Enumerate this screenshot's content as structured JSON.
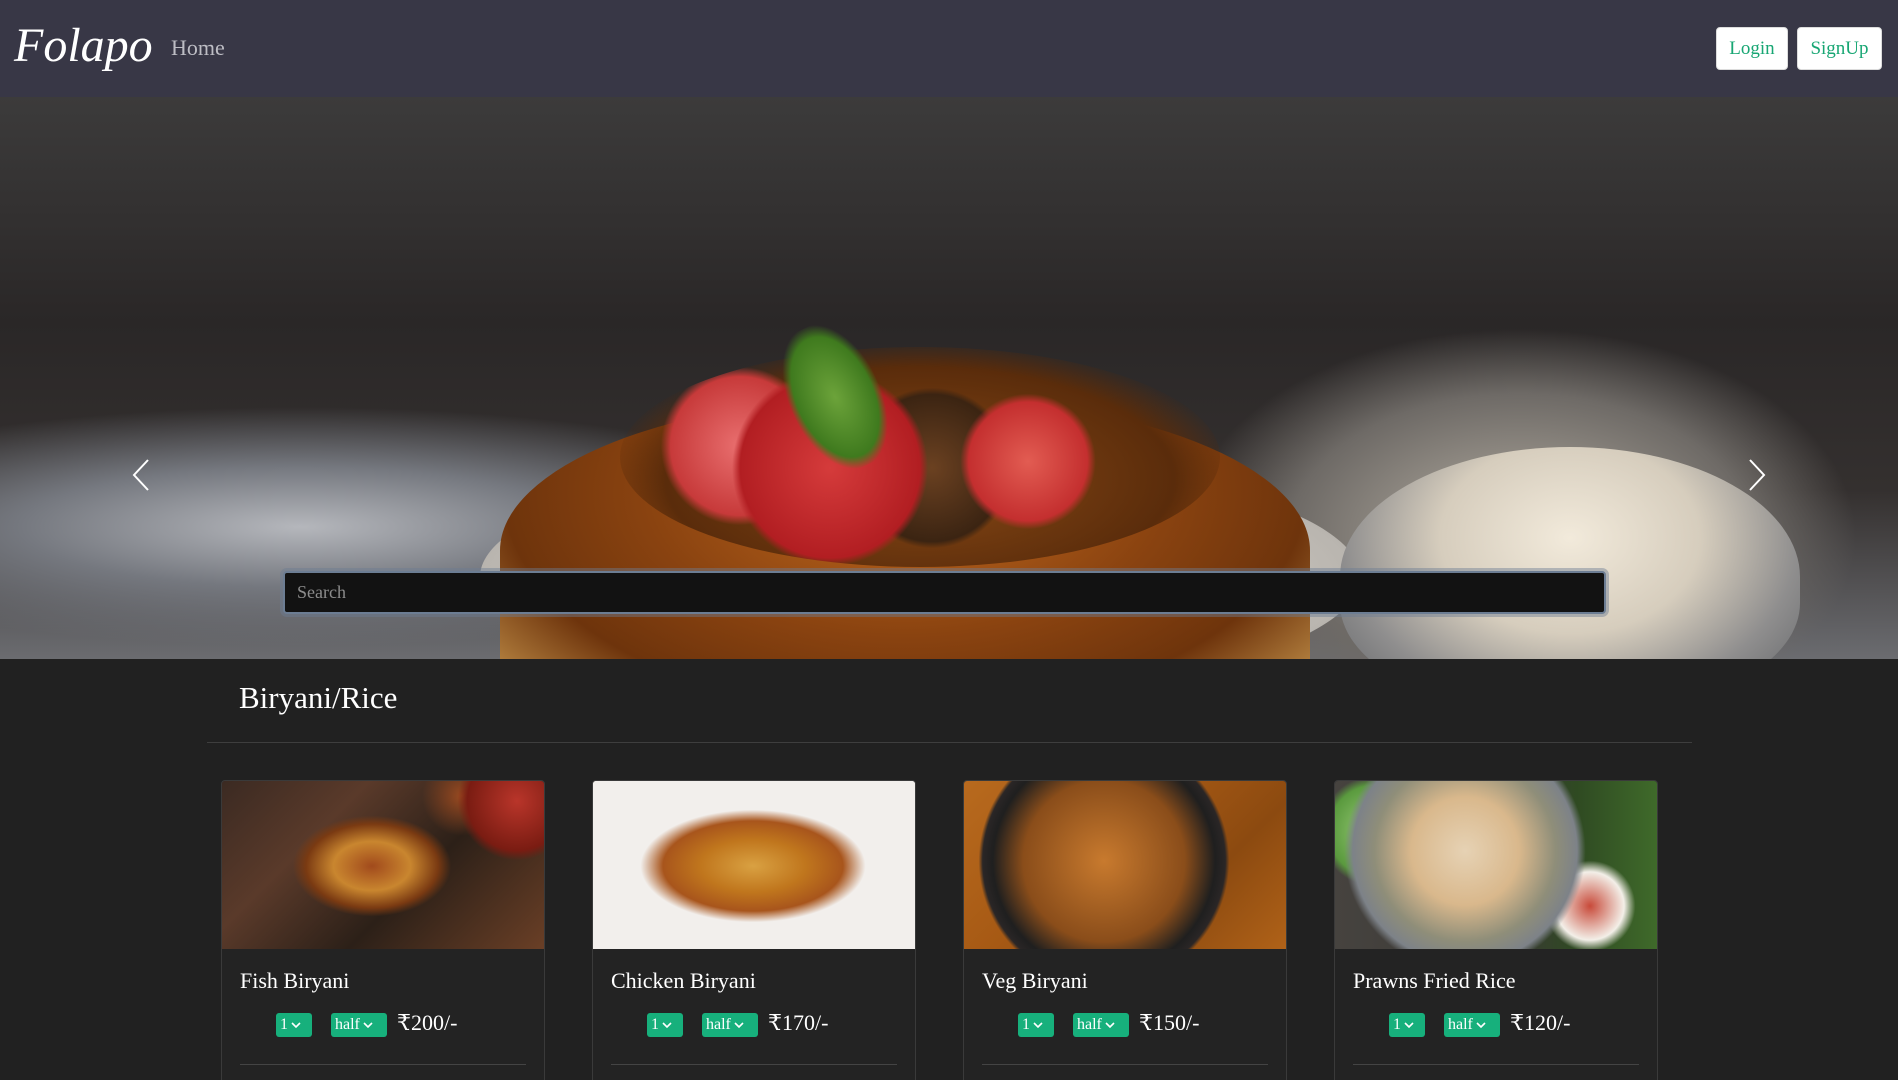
{
  "navbar": {
    "brand": "Folapo",
    "home_label": "Home",
    "login_label": "Login",
    "signup_label": "SignUp"
  },
  "hero": {
    "search_placeholder": "Search",
    "prev_icon": "chevron-left-icon",
    "next_icon": "chevron-right-icon"
  },
  "section": {
    "title": "Biryani/Rice"
  },
  "items": [
    {
      "name": "Fish Biryani",
      "qty": "1",
      "size": "half",
      "price": "₹200/-",
      "image": "fish-biryani-image"
    },
    {
      "name": "Chicken Biryani",
      "qty": "1",
      "size": "half",
      "price": "₹170/-",
      "image": "chicken-biryani-image"
    },
    {
      "name": "Veg Biryani",
      "qty": "1",
      "size": "half",
      "price": "₹150/-",
      "image": "veg-biryani-image"
    },
    {
      "name": "Prawns Fried Rice",
      "qty": "1",
      "size": "half",
      "price": "₹120/-",
      "image": "prawns-fried-rice-image"
    }
  ],
  "colors": {
    "navbar_bg": "#383746",
    "page_bg": "#212121",
    "accent_green": "#17b07c",
    "button_text_green": "#17a673"
  }
}
